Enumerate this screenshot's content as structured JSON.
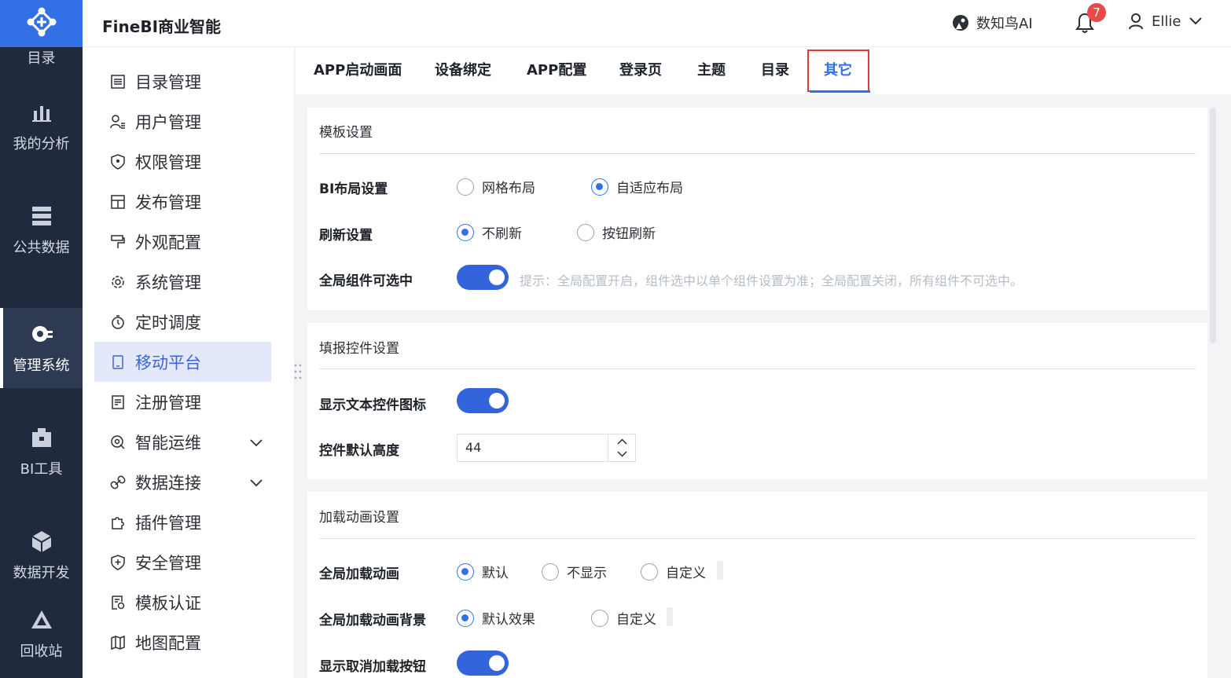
{
  "header": {
    "app_title": "FineBI商业智能",
    "ai_label": "数知鸟AI",
    "notification_count": "7",
    "username": "Ellie"
  },
  "rail": {
    "top_label": "目录",
    "items": [
      {
        "label": "我的分析",
        "icon": "chart-icon"
      },
      {
        "label": "公共数据",
        "icon": "database-icon"
      },
      {
        "label": "管理系统",
        "icon": "gear-icon"
      },
      {
        "label": "BI工具",
        "icon": "toolbox-icon"
      },
      {
        "label": "数据开发",
        "icon": "cube-icon"
      },
      {
        "label": "回收站",
        "icon": "recycle-icon"
      }
    ]
  },
  "sidenav": {
    "items": [
      {
        "label": "目录管理"
      },
      {
        "label": "用户管理"
      },
      {
        "label": "权限管理"
      },
      {
        "label": "发布管理"
      },
      {
        "label": "外观配置"
      },
      {
        "label": "系统管理"
      },
      {
        "label": "定时调度"
      },
      {
        "label": "移动平台"
      },
      {
        "label": "注册管理"
      },
      {
        "label": "智能运维"
      },
      {
        "label": "数据连接"
      },
      {
        "label": "插件管理"
      },
      {
        "label": "安全管理"
      },
      {
        "label": "模板认证"
      },
      {
        "label": "地图配置"
      }
    ]
  },
  "tabs": [
    "APP启动画面",
    "设备绑定",
    "APP配置",
    "登录页",
    "主题",
    "目录",
    "其它"
  ],
  "template_settings": {
    "title": "模板设置",
    "layout_label": "BI布局设置",
    "layout_options": [
      "网格布局",
      "自适应布局"
    ],
    "refresh_label": "刷新设置",
    "refresh_options": [
      "不刷新",
      "按钮刷新"
    ],
    "selectable_label": "全局组件可选中",
    "selectable_hint": "提示：全局配置开启，组件选中以单个组件设置为准；全局配置关闭，所有组件不可选中。"
  },
  "fill_settings": {
    "title": "填报控件设置",
    "show_icon_label": "显示文本控件图标",
    "height_label": "控件默认高度",
    "height_value": "44"
  },
  "loading_settings": {
    "title": "加载动画设置",
    "anim_label": "全局加载动画",
    "anim_options": [
      "默认",
      "不显示",
      "自定义"
    ],
    "bg_label": "全局加载动画背景",
    "bg_options": [
      "默认效果",
      "自定义"
    ],
    "cancel_label": "显示取消加载按钮"
  }
}
